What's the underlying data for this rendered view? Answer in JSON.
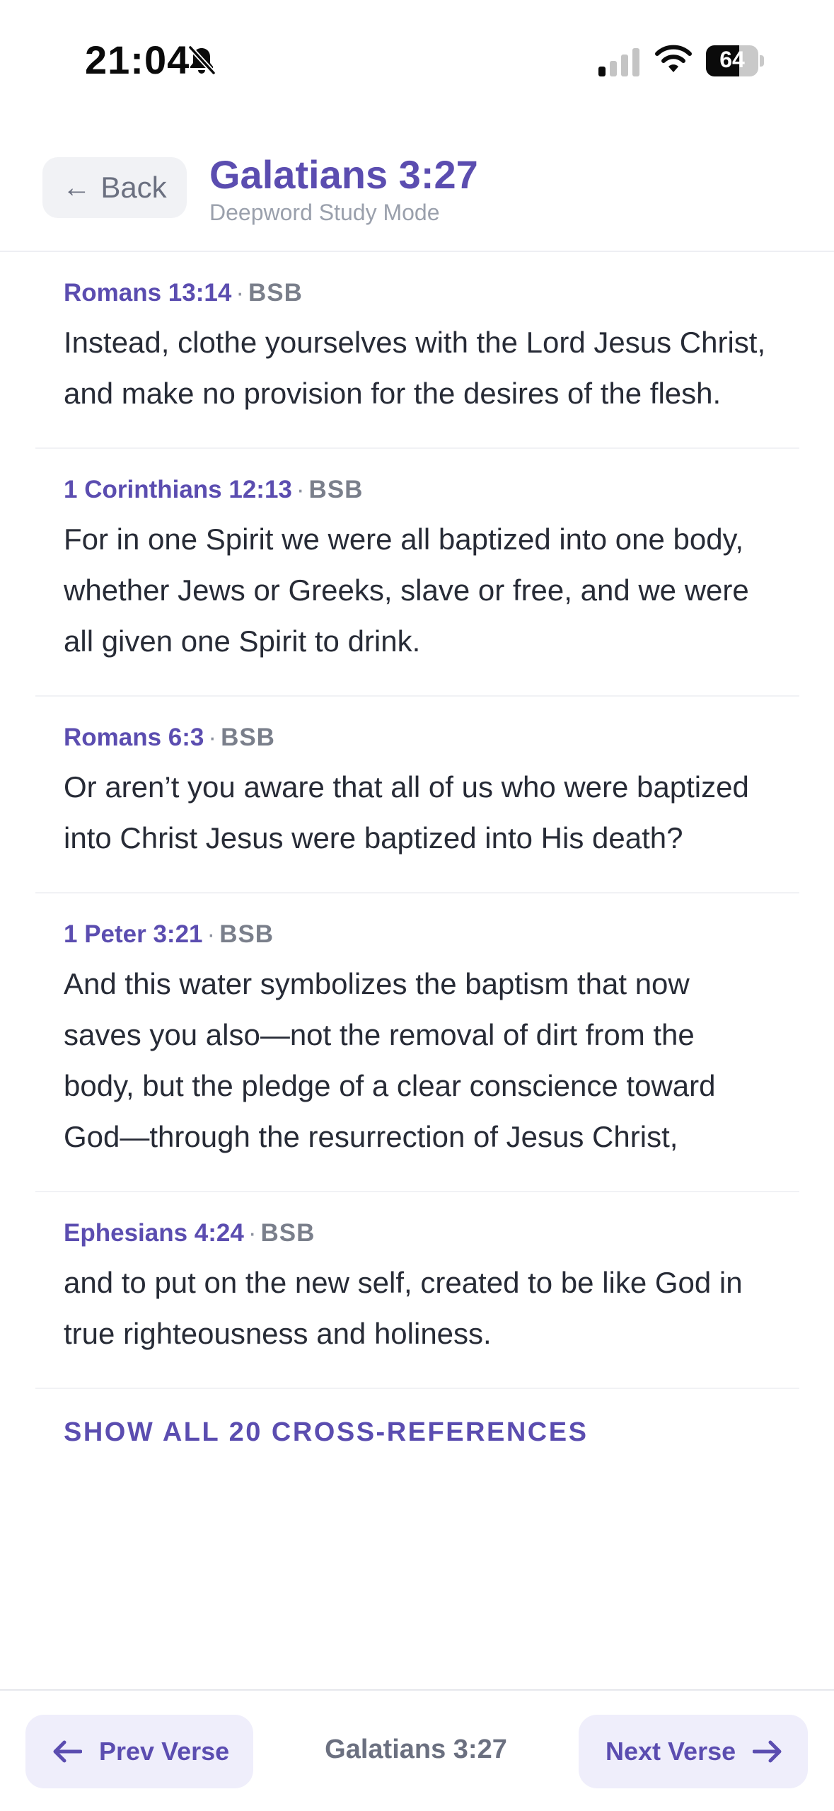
{
  "status_bar": {
    "time": "21:04",
    "battery_level": "64",
    "battery_fraction": 0.64,
    "icons": [
      "bell-slash-icon",
      "cellular-signal-icon",
      "wifi-icon",
      "battery-icon"
    ]
  },
  "header": {
    "back_label": "Back",
    "title": "Galatians 3:27",
    "subtitle": "Deepword Study Mode"
  },
  "references": [
    {
      "ref": "Romans 13:14",
      "translation": "BSB",
      "text": "Instead, clothe yourselves with the Lord Jesus Christ, and make no provision for the desires of the flesh."
    },
    {
      "ref": "1 Corinthians 12:13",
      "translation": "BSB",
      "text": "For in one Spirit we were all baptized into one body, whether Jews or Greeks, slave or free, and we were all given one Spirit to drink."
    },
    {
      "ref": "Romans 6:3",
      "translation": "BSB",
      "text": "Or aren’t you aware that all of us who were baptized into Christ Jesus were baptized into His death?"
    },
    {
      "ref": "1 Peter 3:21",
      "translation": "BSB",
      "text": "And this water symbolizes the baptism that now saves you also—not the removal of dirt from the body, but the pledge of a clear conscience toward God—through the resurrection of Jesus Christ,"
    },
    {
      "ref": "Ephesians 4:24",
      "translation": "BSB",
      "text": "and to put on the new self, created to be like God in true righteousness and holiness."
    }
  ],
  "show_all_label": "SHOW ALL 20 CROSS-REFERENCES",
  "bottom_bar": {
    "prev_label": "Prev Verse",
    "current": "Galatians 3:27",
    "next_label": "Next Verse"
  },
  "colors": {
    "accent": "#5b4db0",
    "button_bg": "#efeefb",
    "muted": "#6b7080"
  }
}
